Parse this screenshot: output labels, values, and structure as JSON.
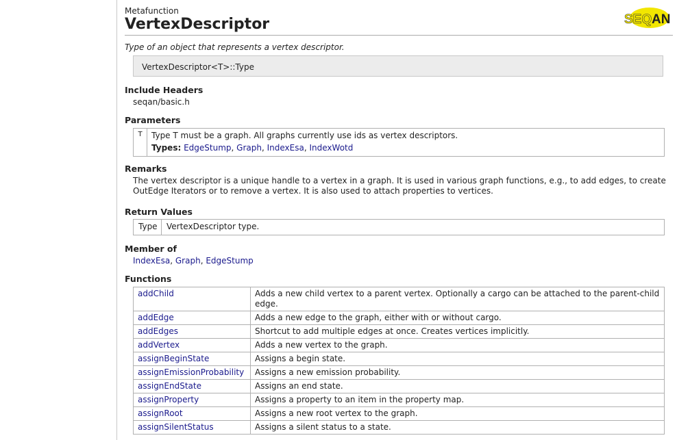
{
  "header": {
    "kind": "Metafunction",
    "title": "VertexDescriptor",
    "logo_text": "SEQAN"
  },
  "summary": "Type of an object that represents a vertex descriptor.",
  "signature": "VertexDescriptor<T>::Type",
  "include_headers": {
    "title": "Include Headers",
    "value": "seqan/basic.h"
  },
  "parameters": {
    "title": "Parameters",
    "name": "T",
    "description": "Type T must be a graph. All graphs currently use ids as vertex descriptors.",
    "types_label": "Types:",
    "types": [
      "EdgeStump",
      "Graph",
      "IndexEsa",
      "IndexWotd"
    ]
  },
  "remarks": {
    "title": "Remarks",
    "line1": "The vertex descriptor is a unique handle to a vertex in a graph. It is used in various graph functions, e.g., to add edges, to create",
    "line2": "OutEdge Iterators or to remove a vertex. It is also used to attach properties to vertices."
  },
  "return_values": {
    "title": "Return Values",
    "name": "Type",
    "description": "VertexDescriptor type."
  },
  "member_of": {
    "title": "Member of",
    "items": [
      "IndexEsa",
      "Graph",
      "EdgeStump"
    ]
  },
  "functions": {
    "title": "Functions",
    "rows": [
      {
        "name": "addChild",
        "desc": "Adds a new child vertex to a parent vertex. Optionally a cargo can be attached to the parent-child edge."
      },
      {
        "name": "addEdge",
        "desc": "Adds a new edge to the graph, either with or without cargo."
      },
      {
        "name": "addEdges",
        "desc": "Shortcut to add multiple edges at once. Creates vertices implicitly."
      },
      {
        "name": "addVertex",
        "desc": "Adds a new vertex to the graph."
      },
      {
        "name": "assignBeginState",
        "desc": "Assigns a begin state."
      },
      {
        "name": "assignEmissionProbability",
        "desc": "Assigns a new emission probability."
      },
      {
        "name": "assignEndState",
        "desc": "Assigns an end state."
      },
      {
        "name": "assignProperty",
        "desc": "Assigns a property to an item in the property map."
      },
      {
        "name": "assignRoot",
        "desc": "Assigns a new root vertex to the graph."
      },
      {
        "name": "assignSilentStatus",
        "desc": "Assigns a silent status to a state."
      }
    ]
  }
}
